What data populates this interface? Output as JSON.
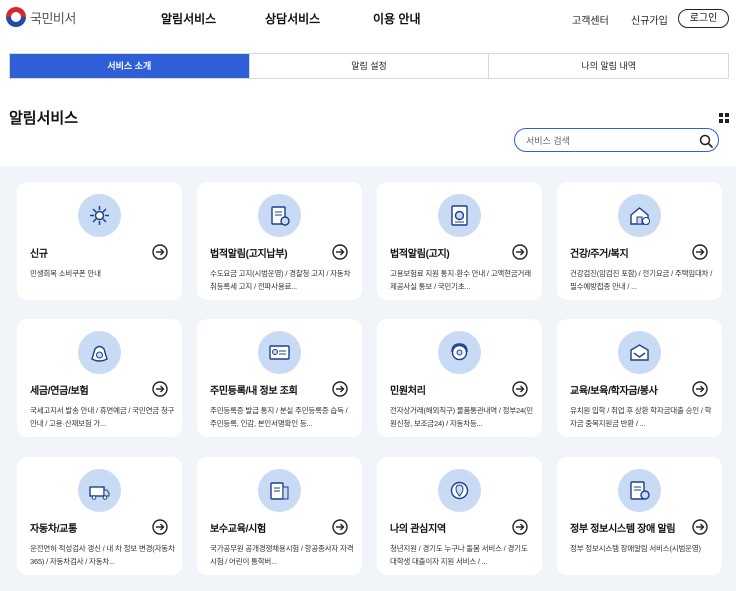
{
  "header": {
    "logo_text": "국민비서",
    "nav": [
      "알림서비스",
      "상담서비스",
      "이용 안내"
    ],
    "util": [
      "고객센터",
      "신규가입"
    ],
    "login_label": "로그인"
  },
  "tabs": [
    {
      "label": "서비스 소개",
      "active": true
    },
    {
      "label": "알림 설정",
      "active": false
    },
    {
      "label": "나의 알림 내역",
      "active": false
    }
  ],
  "page_title": "알림서비스",
  "search": {
    "placeholder": "서비스 검색"
  },
  "cards": [
    {
      "title": "신규",
      "desc": "민생회복 소비쿠폰 안내",
      "icon": "new-service-icon"
    },
    {
      "title": "법적알림(고지납부)",
      "desc": "수도요금 고지(시범운영) / 경찰청 고지 / 자동차 취등록세 고지 / 전파사용료...",
      "icon": "legal-notice-payment-icon"
    },
    {
      "title": "법적알림(고지)",
      "desc": "고용보험료 지원 통지·환수 안내 / 고액현금거래 제공사실 통보 / 국민기초...",
      "icon": "legal-notice-icon"
    },
    {
      "title": "건강/주거/복지",
      "desc": "건강검진(암검진 포함) / 전기요금 / 주택임대차 / 필수예방접종 안내 / ...",
      "icon": "health-housing-icon"
    },
    {
      "title": "세금/연금/보험",
      "desc": "국세고지서 발송 안내 / 휴면예금 / 국민연금 청구안내 / 고용·산재보험 가...",
      "icon": "tax-pension-icon"
    },
    {
      "title": "주민등록/내 정보 조회",
      "desc": "주민등록증 발급 통지 / 분실 주민등록증 습득 / 주민등록, 인감, 본인서명확인 등...",
      "icon": "resident-id-icon"
    },
    {
      "title": "민원처리",
      "desc": "전자상거래(해외직구) 물품통관내역 / 정부24(민원신청, 보조금24) / 자동차등...",
      "icon": "civil-service-icon"
    },
    {
      "title": "교육/보육/학자금/봉사",
      "desc": "유치원 입학 / 취업 후 상환 학자금대출 승인 / 학자금 중복지원금 반환 / ...",
      "icon": "education-icon"
    },
    {
      "title": "자동차/교통",
      "desc": "운전면허 적성검사 갱신 / 내 차 정보 변경(자동차365) / 자동차검사 / 자동차...",
      "icon": "vehicle-traffic-icon"
    },
    {
      "title": "보수교육/시험",
      "desc": "국가공무원 공개경쟁채용시험 / 항공종사자 자격 시험 / 어린이 통학버...",
      "icon": "training-exam-icon"
    },
    {
      "title": "나의 관심지역",
      "desc": "청년지원 / 경기도 누구나 돌봄 서비스 / 경기도 대학생 대출이자 지원 서비스 / ...",
      "icon": "interest-region-icon"
    },
    {
      "title": "정부 정보시스템 장애 알림",
      "desc": "정부 정보시스템 장애알림 서비스(시범운영)",
      "icon": "system-outage-icon"
    }
  ],
  "colors": {
    "accent": "#2f5fd6",
    "icon_bg": "#c9daf5",
    "content_bg": "#f1f4f9"
  }
}
